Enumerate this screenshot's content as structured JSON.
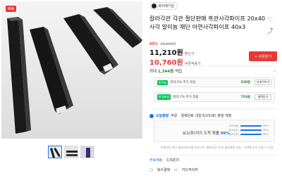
{
  "product": {
    "title": "칼라각관 각관 절단판매 흑관사각파이프 20x40 사각 알미늄 재단 아연사각파이프 40x3",
    "badge": "배송",
    "store_name": "세아메가샵"
  },
  "pricing": {
    "discount_rate": "45%",
    "original_price": "20,000원",
    "sale_price": "11,210원",
    "sale_price_unit": "할인가",
    "coupon_price": "10,760원",
    "coupon_price_unit": "쿠폰적용가",
    "coupon_button": "+ 쿠폰받기"
  },
  "points": {
    "header_prefix": "최대",
    "header_amount": "1,344원",
    "header_suffix": "적립",
    "rows": [
      {
        "tag": "N Pay",
        "text": "최대 5% 추가 적립",
        "value": "538원",
        "button": "자세히보기"
      },
      {
        "tag": "N 멤버십",
        "text": "최대 7% 추가 적립",
        "value": "753원",
        "button": "혜택받기"
      }
    ]
  },
  "shipping": {
    "label_prefix": "오늘출발",
    "label_rest": "주문 · 결제완료 내일 6/25(화) 출발 예정",
    "arrival_text": "9/1(화)까지 도착 확률",
    "arrival_pct": "99%",
    "bars": [
      {
        "label": "6/25(화)",
        "pct": "99%",
        "value": 0.99
      },
      {
        "label": "6/26(수)",
        "pct": "99%",
        "value": 0.99
      },
      {
        "label": "6/27(목)",
        "pct": "99%",
        "value": 0.99
      }
    ],
    "notice": "판매처의 최근 배송데이터를 바탕으로 예측(2일 이내) 출발예정 지표 · 지역별 차이 있을 수 있음"
  },
  "footer": {
    "link_1": "무료배송",
    "link_2": "C/S문의",
    "link_3": "복수결제",
    "link_4": "카드무이자"
  },
  "colors": {
    "accent": "#e53935",
    "brand": "#03c75a",
    "info": "#1a73e8"
  },
  "icons": [
    "heart-icon",
    "share-icon",
    "cart-icon",
    "truck-icon",
    "chevron-down-icon"
  ]
}
